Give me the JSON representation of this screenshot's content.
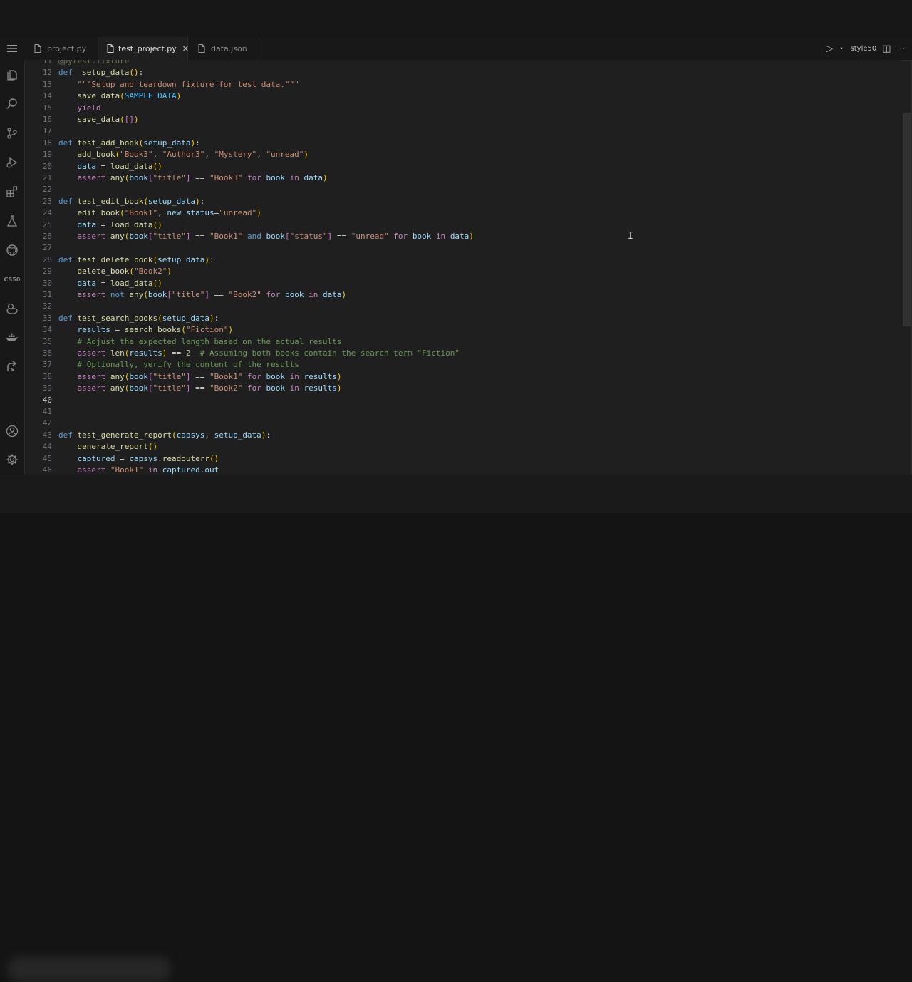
{
  "tabs": [
    {
      "label": "project.py",
      "icon": "file-icon",
      "active": false
    },
    {
      "label": "test_project.py",
      "icon": "file-icon",
      "active": true,
      "close": "✕"
    },
    {
      "label": "data.json",
      "icon": "file-icon",
      "active": false
    }
  ],
  "toolbar": {
    "run_label": "▷",
    "dropdown_label": "⌄",
    "style_label": "style50",
    "split_label": "◫",
    "more_label": "···"
  },
  "activity_bar": {
    "items": [
      "files-icon",
      "search-icon",
      "source-control-icon",
      "run-debug-icon",
      "extensions-icon",
      "testing-icon",
      "github-icon",
      "cs50-icon",
      "ducky-icon",
      "docker-icon",
      "remote-icon"
    ],
    "cs50_label": "CS50",
    "account": "account-icon",
    "settings": "gear-icon"
  },
  "editor": {
    "cursor_line": 40,
    "lines": [
      {
        "n": "11",
        "t": [
          [
            "dec",
            "@pytest.fixture"
          ]
        ]
      },
      {
        "n": "12",
        "t": [
          [
            "kw",
            "def"
          ],
          [
            "",
            "  "
          ],
          [
            "fn",
            "setup_data"
          ],
          [
            "br1",
            "()"
          ],
          [
            "",
            ":"
          ]
        ]
      },
      {
        "n": "13",
        "t": [
          [
            "",
            "    "
          ],
          [
            "str",
            "\"\"\"Setup and teardown fixture for test data.\"\"\""
          ]
        ]
      },
      {
        "n": "14",
        "t": [
          [
            "",
            "    "
          ],
          [
            "fn",
            "save_data"
          ],
          [
            "br1",
            "("
          ],
          [
            "cst",
            "SAMPLE_DATA"
          ],
          [
            "br1",
            ")"
          ]
        ]
      },
      {
        "n": "15",
        "t": [
          [
            "",
            "    "
          ],
          [
            "ctl",
            "yield"
          ]
        ]
      },
      {
        "n": "16",
        "t": [
          [
            "",
            "    "
          ],
          [
            "fn",
            "save_data"
          ],
          [
            "br1",
            "("
          ],
          [
            "br2",
            "[]"
          ],
          [
            "br1",
            ")"
          ]
        ]
      },
      {
        "n": "17",
        "t": []
      },
      {
        "n": "18",
        "t": [
          [
            "kw",
            "def"
          ],
          [
            "",
            " "
          ],
          [
            "fn",
            "test_add_book"
          ],
          [
            "br1",
            "("
          ],
          [
            "var",
            "setup_data"
          ],
          [
            "br1",
            ")"
          ],
          [
            "",
            ":"
          ]
        ]
      },
      {
        "n": "19",
        "t": [
          [
            "",
            "    "
          ],
          [
            "fn",
            "add_book"
          ],
          [
            "br1",
            "("
          ],
          [
            "str",
            "\"Book3\""
          ],
          [
            "",
            ", "
          ],
          [
            "str",
            "\"Author3\""
          ],
          [
            "",
            ", "
          ],
          [
            "str",
            "\"Mystery\""
          ],
          [
            "",
            ", "
          ],
          [
            "str",
            "\"unread\""
          ],
          [
            "br1",
            ")"
          ]
        ]
      },
      {
        "n": "20",
        "t": [
          [
            "",
            "    "
          ],
          [
            "var",
            "data"
          ],
          [
            "",
            " = "
          ],
          [
            "fn",
            "load_data"
          ],
          [
            "br1",
            "()"
          ]
        ]
      },
      {
        "n": "21",
        "t": [
          [
            "",
            "    "
          ],
          [
            "ctl",
            "assert"
          ],
          [
            "",
            " "
          ],
          [
            "fn",
            "any"
          ],
          [
            "br1",
            "("
          ],
          [
            "var",
            "book"
          ],
          [
            "br2",
            "["
          ],
          [
            "str",
            "\"title\""
          ],
          [
            "br2",
            "]"
          ],
          [
            "",
            " == "
          ],
          [
            "str",
            "\"Book3\""
          ],
          [
            "",
            " "
          ],
          [
            "ctl",
            "for"
          ],
          [
            "",
            " "
          ],
          [
            "var",
            "book"
          ],
          [
            "",
            " "
          ],
          [
            "ctl",
            "in"
          ],
          [
            "",
            " "
          ],
          [
            "var",
            "data"
          ],
          [
            "br1",
            ")"
          ]
        ]
      },
      {
        "n": "22",
        "t": []
      },
      {
        "n": "23",
        "t": [
          [
            "kw",
            "def"
          ],
          [
            "",
            " "
          ],
          [
            "fn",
            "test_edit_book"
          ],
          [
            "br1",
            "("
          ],
          [
            "var",
            "setup_data"
          ],
          [
            "br1",
            ")"
          ],
          [
            "",
            ":"
          ]
        ]
      },
      {
        "n": "24",
        "t": [
          [
            "",
            "    "
          ],
          [
            "fn",
            "edit_book"
          ],
          [
            "br1",
            "("
          ],
          [
            "str",
            "\"Book1\""
          ],
          [
            "",
            ", "
          ],
          [
            "var",
            "new_status"
          ],
          [
            "",
            "="
          ],
          [
            "str",
            "\"unread\""
          ],
          [
            "br1",
            ")"
          ]
        ]
      },
      {
        "n": "25",
        "t": [
          [
            "",
            "    "
          ],
          [
            "var",
            "data"
          ],
          [
            "",
            " = "
          ],
          [
            "fn",
            "load_data"
          ],
          [
            "br1",
            "()"
          ]
        ]
      },
      {
        "n": "26",
        "t": [
          [
            "",
            "    "
          ],
          [
            "ctl",
            "assert"
          ],
          [
            "",
            " "
          ],
          [
            "fn",
            "any"
          ],
          [
            "br1",
            "("
          ],
          [
            "var",
            "book"
          ],
          [
            "br2",
            "["
          ],
          [
            "str",
            "\"title\""
          ],
          [
            "br2",
            "]"
          ],
          [
            "",
            " == "
          ],
          [
            "str",
            "\"Book1\""
          ],
          [
            "",
            " "
          ],
          [
            "kw",
            "and"
          ],
          [
            "",
            " "
          ],
          [
            "var",
            "book"
          ],
          [
            "br2",
            "["
          ],
          [
            "str",
            "\"status\""
          ],
          [
            "br2",
            "]"
          ],
          [
            "",
            " == "
          ],
          [
            "str",
            "\"unread\""
          ],
          [
            "",
            " "
          ],
          [
            "ctl",
            "for"
          ],
          [
            "",
            " "
          ],
          [
            "var",
            "book"
          ],
          [
            "",
            " "
          ],
          [
            "ctl",
            "in"
          ],
          [
            "",
            " "
          ],
          [
            "var",
            "data"
          ],
          [
            "br1",
            ")"
          ]
        ]
      },
      {
        "n": "27",
        "t": []
      },
      {
        "n": "28",
        "t": [
          [
            "kw",
            "def"
          ],
          [
            "",
            " "
          ],
          [
            "fn",
            "test_delete_book"
          ],
          [
            "br1",
            "("
          ],
          [
            "var",
            "setup_data"
          ],
          [
            "br1",
            ")"
          ],
          [
            "",
            ":"
          ]
        ]
      },
      {
        "n": "29",
        "t": [
          [
            "",
            "    "
          ],
          [
            "fn",
            "delete_book"
          ],
          [
            "br1",
            "("
          ],
          [
            "str",
            "\"Book2\""
          ],
          [
            "br1",
            ")"
          ]
        ]
      },
      {
        "n": "30",
        "t": [
          [
            "",
            "    "
          ],
          [
            "var",
            "data"
          ],
          [
            "",
            " = "
          ],
          [
            "fn",
            "load_data"
          ],
          [
            "br1",
            "()"
          ]
        ]
      },
      {
        "n": "31",
        "t": [
          [
            "",
            "    "
          ],
          [
            "ctl",
            "assert"
          ],
          [
            "",
            " "
          ],
          [
            "kw",
            "not"
          ],
          [
            "",
            " "
          ],
          [
            "fn",
            "any"
          ],
          [
            "br1",
            "("
          ],
          [
            "var",
            "book"
          ],
          [
            "br2",
            "["
          ],
          [
            "str",
            "\"title\""
          ],
          [
            "br2",
            "]"
          ],
          [
            "",
            " == "
          ],
          [
            "str",
            "\"Book2\""
          ],
          [
            "",
            " "
          ],
          [
            "ctl",
            "for"
          ],
          [
            "",
            " "
          ],
          [
            "var",
            "book"
          ],
          [
            "",
            " "
          ],
          [
            "ctl",
            "in"
          ],
          [
            "",
            " "
          ],
          [
            "var",
            "data"
          ],
          [
            "br1",
            ")"
          ]
        ]
      },
      {
        "n": "32",
        "t": []
      },
      {
        "n": "33",
        "t": [
          [
            "kw",
            "def"
          ],
          [
            "",
            " "
          ],
          [
            "fn",
            "test_search_books"
          ],
          [
            "br1",
            "("
          ],
          [
            "var",
            "setup_data"
          ],
          [
            "br1",
            ")"
          ],
          [
            "",
            ":"
          ]
        ]
      },
      {
        "n": "34",
        "t": [
          [
            "",
            "    "
          ],
          [
            "var",
            "results"
          ],
          [
            "",
            " = "
          ],
          [
            "fn",
            "search_books"
          ],
          [
            "br1",
            "("
          ],
          [
            "str",
            "\"Fiction\""
          ],
          [
            "br1",
            ")"
          ]
        ]
      },
      {
        "n": "35",
        "t": [
          [
            "",
            "    "
          ],
          [
            "cm",
            "# Adjust the expected length based on the actual results"
          ]
        ]
      },
      {
        "n": "36",
        "t": [
          [
            "",
            "    "
          ],
          [
            "ctl",
            "assert"
          ],
          [
            "",
            " "
          ],
          [
            "fn",
            "len"
          ],
          [
            "br1",
            "("
          ],
          [
            "var",
            "results"
          ],
          [
            "br1",
            ")"
          ],
          [
            "",
            " == "
          ],
          [
            "num",
            "2"
          ],
          [
            "",
            "  "
          ],
          [
            "cm",
            "# Assuming both books contain the search term \"Fiction\""
          ]
        ]
      },
      {
        "n": "37",
        "t": [
          [
            "",
            "    "
          ],
          [
            "cm",
            "# Optionally, verify the content of the results"
          ]
        ]
      },
      {
        "n": "38",
        "t": [
          [
            "",
            "    "
          ],
          [
            "ctl",
            "assert"
          ],
          [
            "",
            " "
          ],
          [
            "fn",
            "any"
          ],
          [
            "br1",
            "("
          ],
          [
            "var",
            "book"
          ],
          [
            "br2",
            "["
          ],
          [
            "str",
            "\"title\""
          ],
          [
            "br2",
            "]"
          ],
          [
            "",
            " == "
          ],
          [
            "str",
            "\"Book1\""
          ],
          [
            "",
            " "
          ],
          [
            "ctl",
            "for"
          ],
          [
            "",
            " "
          ],
          [
            "var",
            "book"
          ],
          [
            "",
            " "
          ],
          [
            "ctl",
            "in"
          ],
          [
            "",
            " "
          ],
          [
            "var",
            "results"
          ],
          [
            "br1",
            ")"
          ]
        ]
      },
      {
        "n": "39",
        "t": [
          [
            "",
            "    "
          ],
          [
            "ctl",
            "assert"
          ],
          [
            "",
            " "
          ],
          [
            "fn",
            "any"
          ],
          [
            "br1",
            "("
          ],
          [
            "var",
            "book"
          ],
          [
            "br2",
            "["
          ],
          [
            "str",
            "\"title\""
          ],
          [
            "br2",
            "]"
          ],
          [
            "",
            " == "
          ],
          [
            "str",
            "\"Book2\""
          ],
          [
            "",
            " "
          ],
          [
            "ctl",
            "for"
          ],
          [
            "",
            " "
          ],
          [
            "var",
            "book"
          ],
          [
            "",
            " "
          ],
          [
            "ctl",
            "in"
          ],
          [
            "",
            " "
          ],
          [
            "var",
            "results"
          ],
          [
            "br1",
            ")"
          ]
        ]
      },
      {
        "n": "40",
        "t": []
      },
      {
        "n": "41",
        "t": []
      },
      {
        "n": "42",
        "t": []
      },
      {
        "n": "43",
        "t": [
          [
            "kw",
            "def"
          ],
          [
            "",
            " "
          ],
          [
            "fn",
            "test_generate_report"
          ],
          [
            "br1",
            "("
          ],
          [
            "var",
            "capsys"
          ],
          [
            "",
            ", "
          ],
          [
            "var",
            "setup_data"
          ],
          [
            "br1",
            ")"
          ],
          [
            "",
            ":"
          ]
        ]
      },
      {
        "n": "44",
        "t": [
          [
            "",
            "    "
          ],
          [
            "fn",
            "generate_report"
          ],
          [
            "br1",
            "()"
          ]
        ]
      },
      {
        "n": "45",
        "t": [
          [
            "",
            "    "
          ],
          [
            "var",
            "captured"
          ],
          [
            "",
            " = "
          ],
          [
            "var",
            "capsys"
          ],
          [
            "",
            "."
          ],
          [
            "fn",
            "readouterr"
          ],
          [
            "br1",
            "()"
          ]
        ]
      },
      {
        "n": "46",
        "t": [
          [
            "",
            "    "
          ],
          [
            "ctl",
            "assert"
          ],
          [
            "",
            " "
          ],
          [
            "str",
            "\"Book1\""
          ],
          [
            "",
            " "
          ],
          [
            "ctl",
            "in"
          ],
          [
            "",
            " "
          ],
          [
            "var",
            "captured"
          ],
          [
            "",
            "."
          ],
          [
            "var",
            "out"
          ]
        ]
      }
    ]
  }
}
